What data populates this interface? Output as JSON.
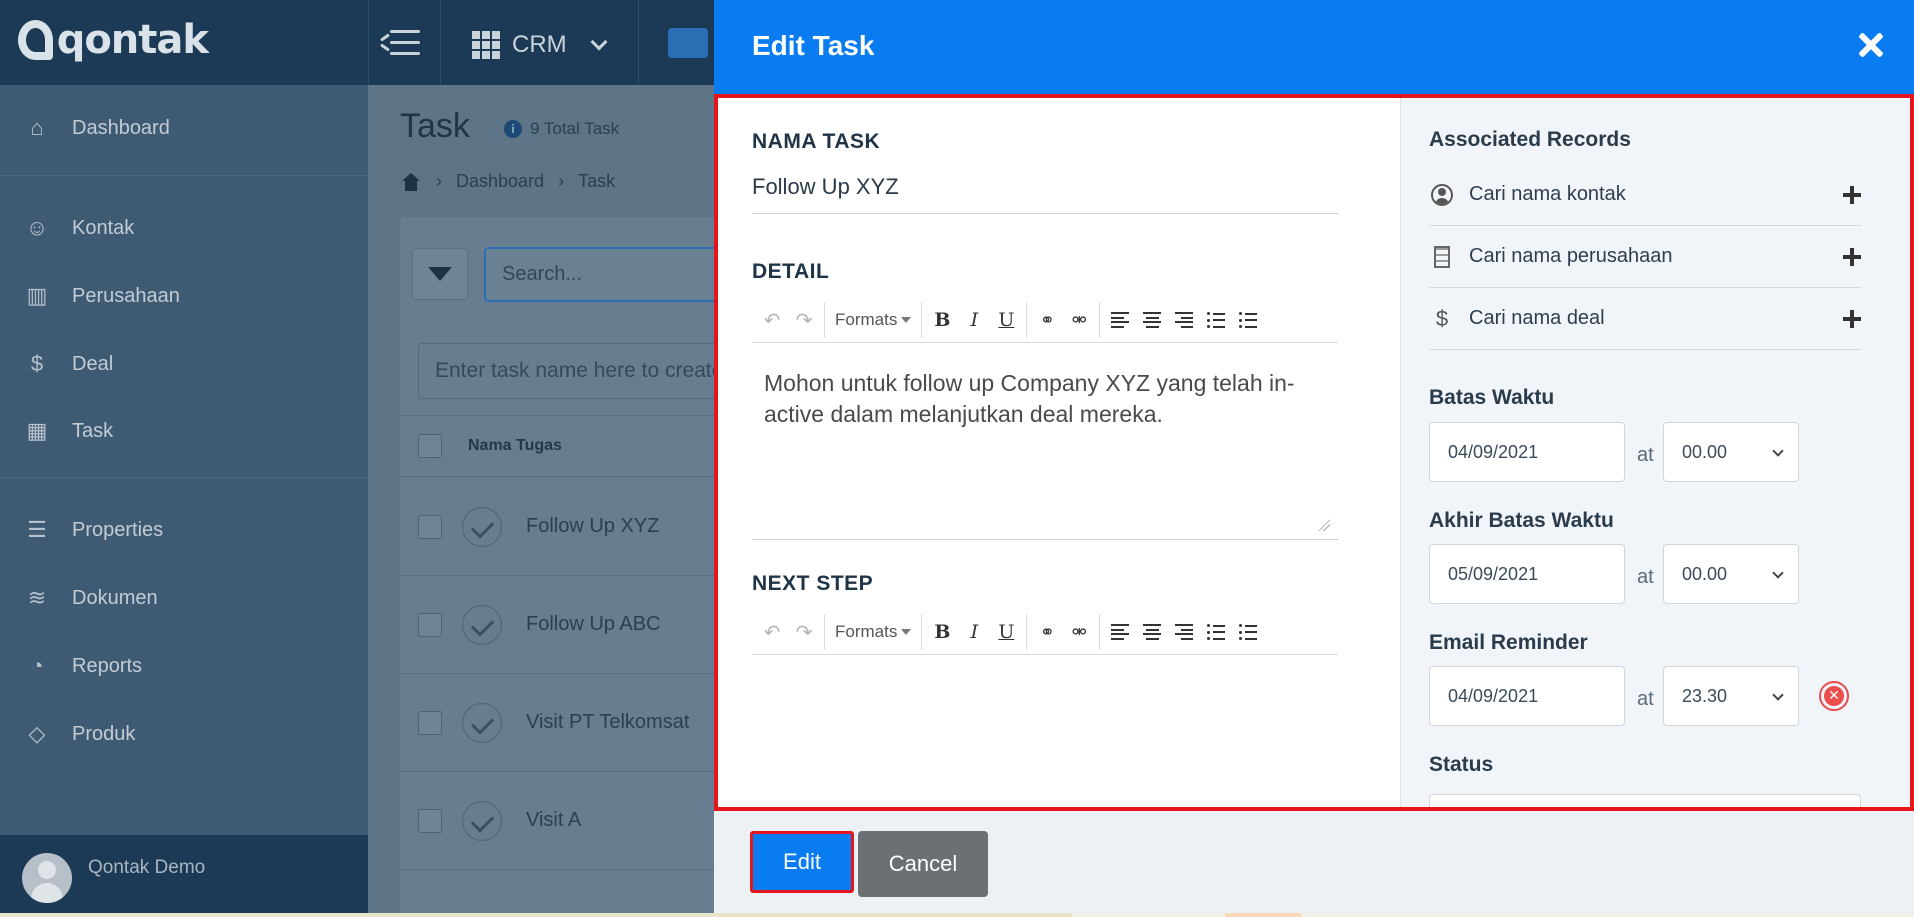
{
  "app": {
    "logo_text": "qontak",
    "crm_label": "CRM"
  },
  "sidebar": {
    "items": [
      {
        "label": "Dashboard",
        "icon": "home-icon"
      },
      {
        "label": "Kontak",
        "icon": "users-icon"
      },
      {
        "label": "Perusahaan",
        "icon": "building-icon"
      },
      {
        "label": "Deal",
        "icon": "dollar-icon"
      },
      {
        "label": "Task",
        "icon": "calendar-icon"
      },
      {
        "label": "Properties",
        "icon": "list-icon"
      },
      {
        "label": "Dokumen",
        "icon": "layers-icon"
      },
      {
        "label": "Reports",
        "icon": "pie-chart-icon"
      },
      {
        "label": "Produk",
        "icon": "tag-icon"
      }
    ],
    "user_name": "Qontak Demo"
  },
  "main": {
    "title": "Task",
    "total": "9 Total Task",
    "breadcrumb": [
      "Dashboard",
      "Task"
    ],
    "search_placeholder": "Search...",
    "new_task_placeholder": "Enter task name here to create",
    "column_header": "Nama Tugas",
    "tasks": [
      "Follow Up XYZ",
      "Follow Up ABC",
      "Visit PT Telkomsat",
      "Visit A"
    ]
  },
  "modal": {
    "title": "Edit Task",
    "nama_task_label": "NAMA TASK",
    "nama_task_value": "Follow Up XYZ",
    "detail_label": "DETAIL",
    "detail_text_line1": "Mohon untuk follow up Company XYZ yang telah in-",
    "detail_text_line2": "active dalam melanjutkan deal mereka.",
    "next_step_label": "NEXT STEP",
    "toolbar": {
      "formats_label": "Formats"
    },
    "associated": {
      "title": "Associated Records",
      "contact_placeholder": "Cari nama kontak",
      "company_placeholder": "Cari nama perusahaan",
      "deal_placeholder": "Cari nama deal"
    },
    "batas_waktu": {
      "label": "Batas Waktu",
      "date": "04/09/2021",
      "at": "at",
      "time": "00.00"
    },
    "akhir_batas_waktu": {
      "label": "Akhir Batas Waktu",
      "date": "05/09/2021",
      "at": "at",
      "time": "00.00"
    },
    "email_reminder": {
      "label": "Email Reminder",
      "date": "04/09/2021",
      "at": "at",
      "time": "23.30"
    },
    "status_label": "Status",
    "buttons": {
      "edit": "Edit",
      "cancel": "Cancel"
    },
    "colors": {
      "primary": "#0a7cf2",
      "highlight": "#e3161d",
      "cancel": "#6b7075"
    }
  }
}
